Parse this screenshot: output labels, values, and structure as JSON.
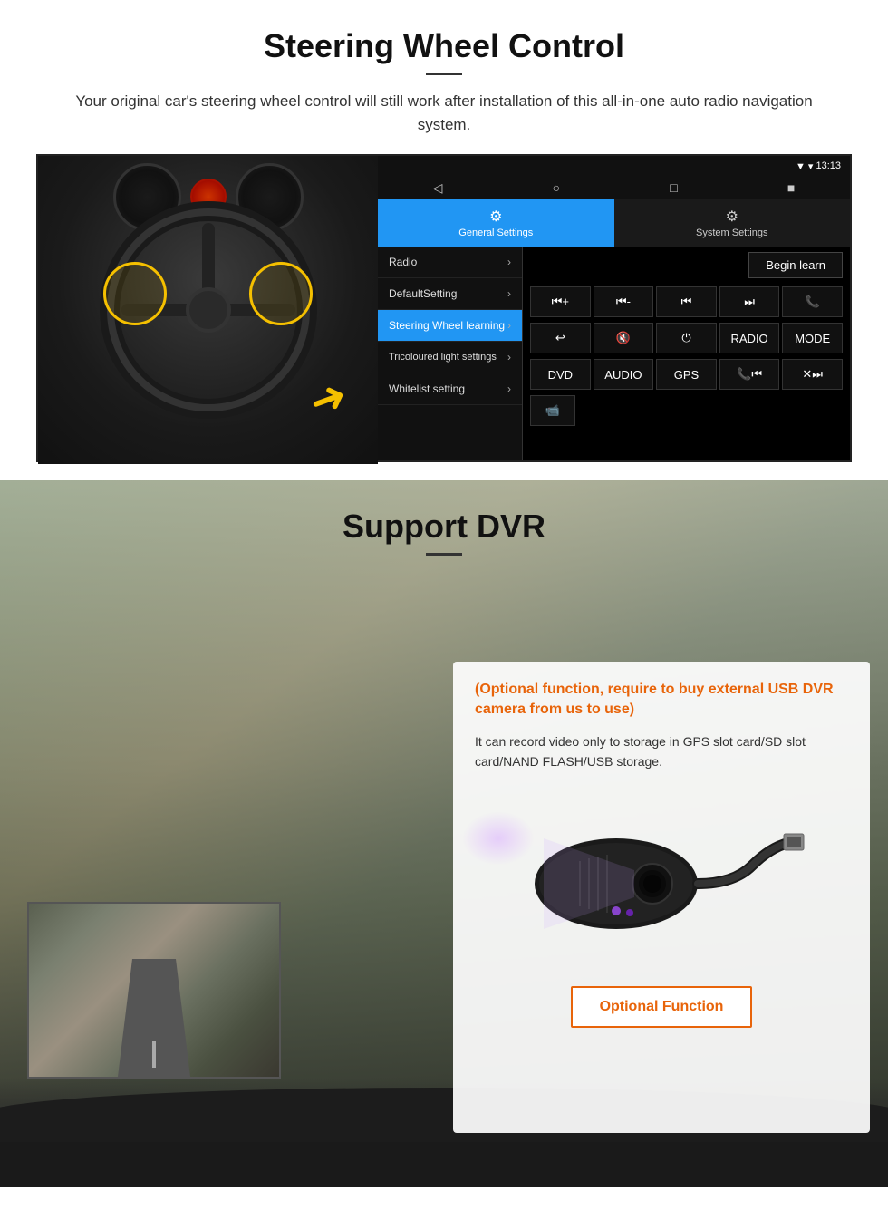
{
  "section1": {
    "title": "Steering Wheel Control",
    "subtitle": "Your original car's steering wheel control will still work after installation of this all-in-one auto radio navigation system.",
    "android_ui": {
      "status_bar": {
        "time": "13:13",
        "signal_icon": "▼",
        "wifi_icon": "▾"
      },
      "nav_buttons": [
        "◁",
        "○",
        "□",
        "■"
      ],
      "tabs": [
        {
          "label": "General Settings",
          "icon": "⚙",
          "active": true
        },
        {
          "label": "System Settings",
          "icon": "⚙",
          "active": false
        }
      ],
      "menu_items": [
        {
          "label": "Radio",
          "active": false
        },
        {
          "label": "DefaultSetting",
          "active": false
        },
        {
          "label": "Steering Wheel learning",
          "active": true
        },
        {
          "label": "Tricoloured light settings",
          "active": false
        },
        {
          "label": "Whitelist setting",
          "active": false
        }
      ],
      "begin_learn_label": "Begin learn",
      "control_buttons_row1": [
        "⏮+",
        "⏮-",
        "⏮",
        "⏭",
        "📞"
      ],
      "control_buttons_row2": [
        "↩",
        "🔇",
        "⏻",
        "RADIO",
        "MODE"
      ],
      "control_buttons_row3": [
        "DVD",
        "AUDIO",
        "GPS",
        "📞⏮",
        "✕⏭"
      ],
      "control_buttons_row4": [
        "📹"
      ]
    }
  },
  "section2": {
    "title": "Support DVR",
    "card": {
      "optional_text": "(Optional function, require to buy external USB DVR camera from us to use)",
      "description": "It can record video only to storage in GPS slot card/SD slot card/NAND FLASH/USB storage.",
      "optional_function_label": "Optional Function"
    }
  }
}
